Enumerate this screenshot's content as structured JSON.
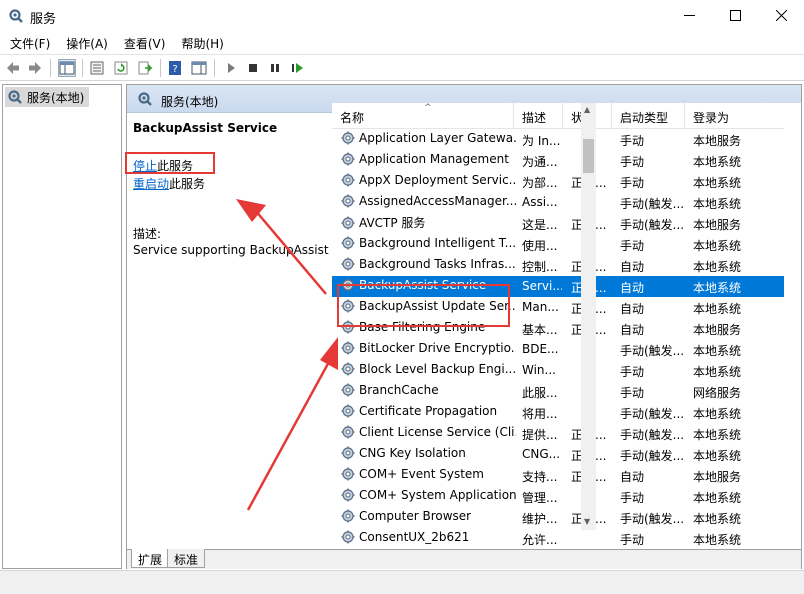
{
  "window": {
    "title": "服务"
  },
  "menu": [
    "文件(F)",
    "操作(A)",
    "查看(V)",
    "帮助(H)"
  ],
  "tree": {
    "item_label": "服务(本地)"
  },
  "panel": {
    "header": "服务(本地)"
  },
  "detail": {
    "service_name": "BackupAssist Service",
    "stop_link": "停止",
    "stop_suffix": "此服务",
    "restart_link": "重启动",
    "restart_suffix": "此服务",
    "desc_label": "描述:",
    "desc_text": "Service supporting BackupAssist"
  },
  "columns": [
    "名称",
    "描述",
    "状态",
    "启动类型",
    "登录为"
  ],
  "services": [
    {
      "name": "Application Layer Gatewa...",
      "desc": "为 In...",
      "status": "",
      "startup": "手动",
      "logon": "本地服务"
    },
    {
      "name": "Application Management",
      "desc": "为通...",
      "status": "",
      "startup": "手动",
      "logon": "本地系统"
    },
    {
      "name": "AppX Deployment Servic...",
      "desc": "为部...",
      "status": "正在...",
      "startup": "手动",
      "logon": "本地系统"
    },
    {
      "name": "AssignedAccessManager...",
      "desc": "Assi...",
      "status": "",
      "startup": "手动(触发...",
      "logon": "本地系统"
    },
    {
      "name": "AVCTP 服务",
      "desc": "这是...",
      "status": "正在...",
      "startup": "手动(触发...",
      "logon": "本地服务"
    },
    {
      "name": "Background Intelligent T...",
      "desc": "使用...",
      "status": "",
      "startup": "手动",
      "logon": "本地系统"
    },
    {
      "name": "Background Tasks Infras...",
      "desc": "控制...",
      "status": "正在...",
      "startup": "自动",
      "logon": "本地系统"
    },
    {
      "name": "BackupAssist Service",
      "desc": "Servi...",
      "status": "正在...",
      "startup": "自动",
      "logon": "本地系统",
      "selected": true
    },
    {
      "name": "BackupAssist Update Ser...",
      "desc": "Man...",
      "status": "正在...",
      "startup": "自动",
      "logon": "本地系统"
    },
    {
      "name": "Base Filtering Engine",
      "desc": "基本...",
      "status": "正在...",
      "startup": "自动",
      "logon": "本地服务"
    },
    {
      "name": "BitLocker Drive Encryptio...",
      "desc": "BDE...",
      "status": "",
      "startup": "手动(触发...",
      "logon": "本地系统"
    },
    {
      "name": "Block Level Backup Engi...",
      "desc": "Win...",
      "status": "",
      "startup": "手动",
      "logon": "本地系统"
    },
    {
      "name": "BranchCache",
      "desc": "此服...",
      "status": "",
      "startup": "手动",
      "logon": "网络服务"
    },
    {
      "name": "Certificate Propagation",
      "desc": "将用...",
      "status": "",
      "startup": "手动(触发...",
      "logon": "本地系统"
    },
    {
      "name": "Client License Service (Cli...",
      "desc": "提供...",
      "status": "正在...",
      "startup": "手动(触发...",
      "logon": "本地系统"
    },
    {
      "name": "CNG Key Isolation",
      "desc": "CNG...",
      "status": "正在...",
      "startup": "手动(触发...",
      "logon": "本地系统"
    },
    {
      "name": "COM+ Event System",
      "desc": "支持...",
      "status": "正在...",
      "startup": "自动",
      "logon": "本地服务"
    },
    {
      "name": "COM+ System Application",
      "desc": "管理...",
      "status": "",
      "startup": "手动",
      "logon": "本地系统"
    },
    {
      "name": "Computer Browser",
      "desc": "维护...",
      "status": "正在...",
      "startup": "手动(触发...",
      "logon": "本地系统"
    },
    {
      "name": "ConsentUX_2b621",
      "desc": "允许...",
      "status": "",
      "startup": "手动",
      "logon": "本地系统"
    }
  ],
  "tabs": [
    "扩展",
    "标准"
  ],
  "colors": {
    "selection": "#0078d7",
    "highlight": "#e53935",
    "link": "#0066cc"
  }
}
